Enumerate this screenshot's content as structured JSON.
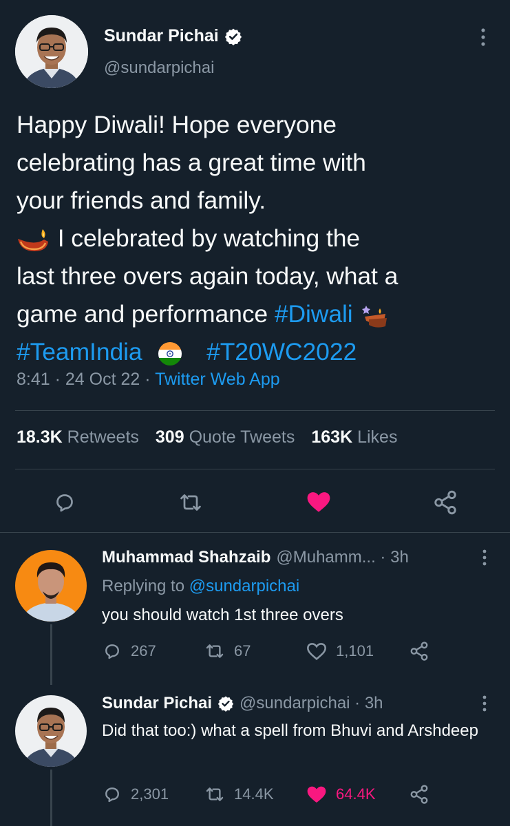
{
  "main_tweet": {
    "author_name": "Sundar Pichai",
    "author_handle": "@sundarpichai",
    "text_lines": [
      "Happy Diwali! Hope everyone",
      "celebrating has a great time with",
      "your friends and family.",
      "I celebrated by watching the",
      "last three overs again today, what a",
      "game and performance"
    ],
    "hashtags": [
      "#Diwali",
      "#TeamIndia",
      "#T20WC2022"
    ],
    "time": "8:41",
    "date": "24 Oct 22",
    "source": "Twitter Web App",
    "retweets_count": "18.3K",
    "retweets_label": "Retweets",
    "quotes_count": "309",
    "quotes_label": "Quote Tweets",
    "likes_count": "163K",
    "likes_label": "Likes",
    "liked": true
  },
  "replies": [
    {
      "author_name": "Muhammad Shahzaib",
      "author_handle": "@Muhamm...",
      "time": "3h",
      "replying_label": "Replying to",
      "replying_to": "@sundarpichai",
      "text": "you should watch 1st three overs",
      "reply_count": "267",
      "retweet_count": "67",
      "like_count": "1,101",
      "liked": false
    },
    {
      "author_name": "Sundar Pichai",
      "author_handle": "@sundarpichai",
      "time": "3h",
      "text": "Did that too:) what a spell from Bhuvi and Arshdeep",
      "reply_count": "2,301",
      "retweet_count": "14.4K",
      "like_count": "64.4K",
      "liked": true
    }
  ],
  "colors": {
    "background": "#15202b",
    "accent": "#1d9bf0",
    "like": "#f91880",
    "secondary_text": "#8b98a5"
  },
  "icons": [
    "verified-badge-icon",
    "more-vertical-icon",
    "reply-icon",
    "retweet-icon",
    "heart-icon",
    "share-icon",
    "diya-emoji-icon",
    "flag-india-emoji-icon"
  ]
}
